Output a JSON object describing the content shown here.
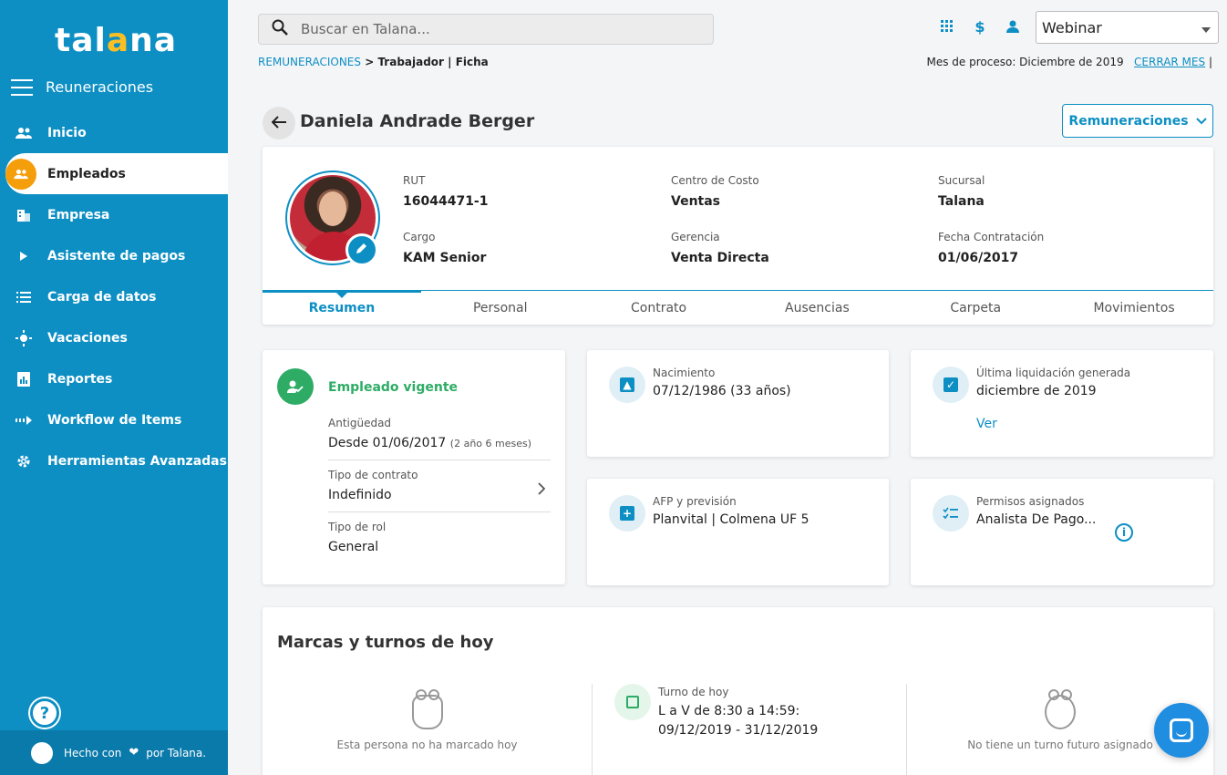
{
  "app": {
    "logo": "talana"
  },
  "sidebar": {
    "module_title": "Reuneraciones",
    "items": [
      {
        "label": "Inicio",
        "icon": "people-icon"
      },
      {
        "label": "Empleados",
        "icon": "people-icon",
        "active": true
      },
      {
        "label": "Empresa",
        "icon": "building-icon"
      },
      {
        "label": "Asistente de pagos",
        "icon": "play-icon"
      },
      {
        "label": "Carga de datos",
        "icon": "list-icon"
      },
      {
        "label": "Vacaciones",
        "icon": "sun-icon"
      },
      {
        "label": "Reportes",
        "icon": "report-icon"
      },
      {
        "label": "Workflow de Items",
        "icon": "workflow-icon"
      },
      {
        "label": "Herramientas Avanzadas",
        "icon": "gear-icon"
      }
    ],
    "help": "?",
    "footer": {
      "prefix": "Hecho con",
      "suffix": "por Talana."
    }
  },
  "topbar": {
    "search_placeholder": "Buscar en Talana...",
    "company_select": "Webinar"
  },
  "breadcrumb": {
    "root": "REMUNERACIONES",
    "sep": " > ",
    "current": "Trabajador | Ficha"
  },
  "process": {
    "label": "Mes de proceso: Diciembre de 2019",
    "close": "CERRAR MES",
    "sep": "|"
  },
  "employee": {
    "name": "Daniela Andrade Berger",
    "module_button": "Remuneraciones",
    "fields": {
      "rut": {
        "label": "RUT",
        "value": "16044471-1"
      },
      "centro": {
        "label": "Centro de Costo",
        "value": "Ventas"
      },
      "sucursal": {
        "label": "Sucursal",
        "value": "Talana"
      },
      "cargo": {
        "label": "Cargo",
        "value": "KAM Senior"
      },
      "gerencia": {
        "label": "Gerencia",
        "value": "Venta Directa"
      },
      "fecha": {
        "label": "Fecha Contratación",
        "value": "01/06/2017"
      }
    },
    "tabs": [
      "Resumen",
      "Personal",
      "Contrato",
      "Ausencias",
      "Carpeta",
      "Movimientos"
    ]
  },
  "status": {
    "title": "Empleado vigente",
    "antiguedad": {
      "label": "Antigüedad",
      "value": "Desde 01/06/2017",
      "detail": "(2 año 6 meses)"
    },
    "contrato": {
      "label": "Tipo de contrato",
      "value": "Indefinido"
    },
    "rol": {
      "label": "Tipo de rol",
      "value": "General"
    }
  },
  "cards": {
    "nacimiento": {
      "label": "Nacimiento",
      "value": "07/12/1986 (33 años)"
    },
    "liquidacion": {
      "label": "Última liquidación generada",
      "value": "diciembre de 2019",
      "link": "Ver"
    },
    "afp": {
      "label": "AFP y previsión",
      "value": "Planvital | Colmena UF 5"
    },
    "permisos": {
      "label": "Permisos asignados",
      "value": "Analista De Pago..."
    }
  },
  "marcas": {
    "title": "Marcas y turnos de hoy",
    "no_marcas": "Esta persona no ha marcado hoy",
    "turno": {
      "label": "Turno de hoy",
      "value": "L a V de 8:30 a 14:59: 09/12/2019 - 31/12/2019"
    },
    "no_futuro": "No tiene un turno futuro asignado"
  },
  "colors": {
    "brand": "#0d8fc4",
    "accent": "#f59e0b",
    "success": "#2eac65"
  }
}
